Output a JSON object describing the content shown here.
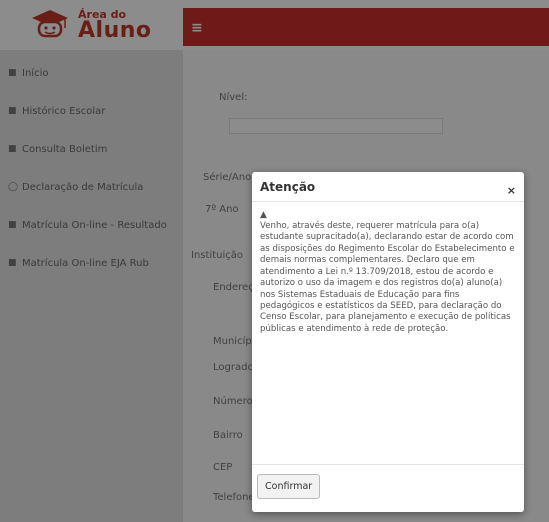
{
  "logo": {
    "line1": "Área do",
    "line2": "Aluno"
  },
  "topbar": {
    "menu_icon": "≡"
  },
  "sidebar": {
    "items": [
      {
        "icon": "■",
        "label": "Início"
      },
      {
        "icon": "■",
        "label": "Histórico Escolar"
      },
      {
        "icon": "■",
        "label": "Consulta Boletim"
      },
      {
        "icon": "◯",
        "label": "Declaração de Matrícula"
      },
      {
        "icon": "■",
        "label": "Matrícula On-line - Resultado"
      },
      {
        "icon": "■",
        "label": "Matrícula On-line EJA Rub"
      }
    ]
  },
  "main": {
    "label_field1": "Nível:",
    "label_section": "Série/Ano",
    "label_year": "7º Ano",
    "label_institution": "Instituição",
    "label_e": "Endereço",
    "label_m": "Município",
    "label_l": "Logradouro",
    "label_n": "Número",
    "label_b": "Bairro",
    "label_c": "CEP",
    "label_t": "Telefone"
  },
  "modal": {
    "title": "Atenção",
    "close_glyph": "×",
    "warn_glyph": "▲",
    "body": "Venho, através deste, requerer matrícula para o(a) estudante supracitado(a), declarando estar de acordo com as disposições do Regimento Escolar do Estabelecimento e demais normas complementares. Declaro que em atendimento a Lei n.º 13.709/2018, estou de acordo e autorizo o uso da imagem e dos registros do(a) aluno(a) nos Sistemas Estaduais de Educação para fins pedagógicos e estatísticos da SEED, para declaração do Censo Escolar, para planejamento e execução de políticas públicas e atendimento à rede de proteção.",
    "confirm_label": "Confirmar"
  },
  "colors": {
    "brand_red": "#cc2e2e"
  }
}
